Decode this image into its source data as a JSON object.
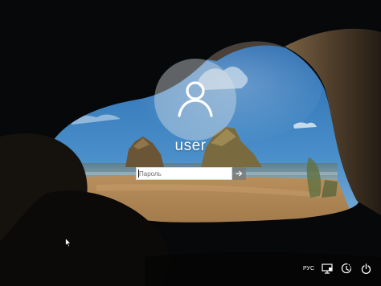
{
  "login": {
    "username": "user",
    "password_placeholder": "Пароль"
  },
  "tray": {
    "language": "РУС"
  },
  "icons": {
    "avatar": "user-silhouette-icon",
    "submit": "arrow-right-icon",
    "network": "network-icon",
    "accessibility": "ease-of-access-icon",
    "power": "power-icon",
    "cursor": "mouse-pointer-icon"
  },
  "colors": {
    "sky": "#3f86c8",
    "sand": "#a98353",
    "rock": "#3a2e22",
    "avatar_circle": "#b8bfc6"
  }
}
